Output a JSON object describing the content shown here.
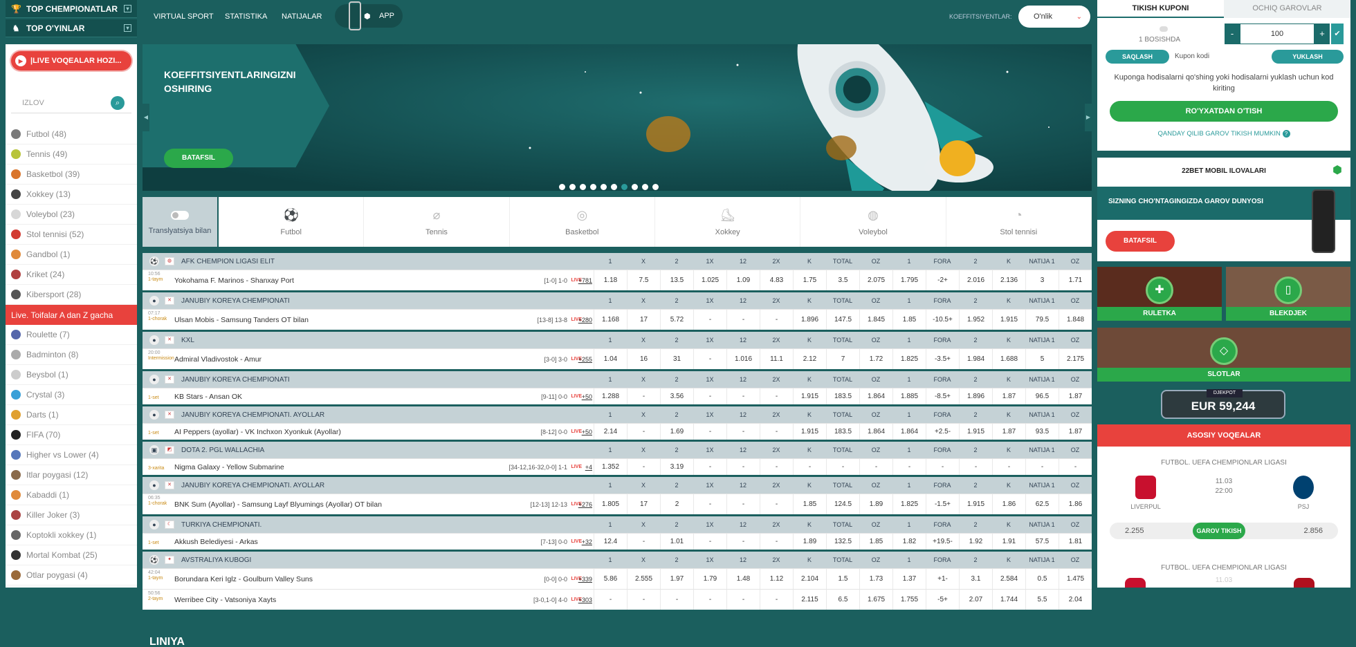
{
  "left": {
    "top_championships": "TOP CHEMPIONATLAR",
    "top_games": "TOP O'YINLAR",
    "live_button": "|LIVE VOQEALAR HOZI...",
    "search_placeholder": "IZLOV",
    "sports_a": [
      {
        "label": "Futbol (48)",
        "color": "#7a7a7a"
      },
      {
        "label": "Tennis (49)",
        "color": "#b8c43a"
      },
      {
        "label": "Basketbol (39)",
        "color": "#d9752b"
      },
      {
        "label": "Xokkey (13)",
        "color": "#444"
      },
      {
        "label": "Voleybol (23)",
        "color": "#d7d7d7"
      },
      {
        "label": "Stol tennisi (52)",
        "color": "#d23b32"
      },
      {
        "label": "Gandbol (1)",
        "color": "#e08a3a"
      },
      {
        "label": "Kriket (24)",
        "color": "#b04040"
      },
      {
        "label": "Kibersport (28)",
        "color": "#555"
      }
    ],
    "live_toggle": "Live. Toifalar A dan Z gacha",
    "sports_b": [
      {
        "label": "Roulette (7)",
        "color": "#5566aa"
      },
      {
        "label": "Badminton (8)",
        "color": "#aaaaaa"
      },
      {
        "label": "Beysbol (1)",
        "color": "#cccccc"
      },
      {
        "label": "Crystal (3)",
        "color": "#3aa0d8"
      },
      {
        "label": "Darts (1)",
        "color": "#e0a030"
      },
      {
        "label": "FIFA (70)",
        "color": "#222222"
      },
      {
        "label": "Higher vs Lower (4)",
        "color": "#5577bb"
      },
      {
        "label": "Itlar poygasi (12)",
        "color": "#8a6a4a"
      },
      {
        "label": "Kabaddi (1)",
        "color": "#e08a3a"
      },
      {
        "label": "Killer Joker (3)",
        "color": "#aa4444"
      },
      {
        "label": "Koptokli xokkey (1)",
        "color": "#666666"
      },
      {
        "label": "Mortal Kombat (25)",
        "color": "#333333"
      },
      {
        "label": "Otlar poygasi (4)",
        "color": "#9a6a3a"
      }
    ]
  },
  "nav": {
    "virtual_sport": "VIRTUAL SPORT",
    "statistika": "STATISTIKA",
    "natijalar": "NATIJALAR",
    "app": "APP",
    "koef_label": "KOEFFITSIYENTLAR:",
    "koef_value": "O'nlik"
  },
  "banner": {
    "title": "KOEFFITSIYENTLARINGIZNI OSHIRING",
    "button": "BATAFSIL"
  },
  "tabs": {
    "translation": "Translyatsiya bilan",
    "items": [
      "Futbol",
      "Tennis",
      "Basketbol",
      "Xokkey",
      "Voleybol",
      "Stol tennisi"
    ]
  },
  "columns": [
    "1",
    "X",
    "2",
    "1X",
    "12",
    "2X",
    "K",
    "TOTAL",
    "OZ",
    "1",
    "FORA",
    "2",
    "K",
    "NATIJA 1",
    "OZ"
  ],
  "events": [
    {
      "league": "AFK CHEMPION LIGASI ELIT",
      "icon": "⚽",
      "flag": "◍",
      "rows": [
        {
          "time": "10:56",
          "period": "1-taym",
          "name": "Yokohama F. Marinos - Shanxay Port",
          "score": "[1-0]  1-0",
          "plus": "+781",
          "odds": [
            "1.18",
            "7.5",
            "13.5",
            "1.025",
            "1.09",
            "4.83",
            "1.75",
            "3.5",
            "2.075",
            "1.795",
            "-2+",
            "2.016",
            "2.136",
            "3",
            "1.71"
          ]
        }
      ]
    },
    {
      "league": "JANUBIY KOREYA CHEMPIONATI",
      "icon": "●",
      "flag": "✕",
      "rows": [
        {
          "time": "07:17",
          "period": "1-chorak",
          "name": "Ulsan Mobis - Samsung Tanders OT bilan",
          "score": "[13-8]  13-8",
          "plus": "+280",
          "odds": [
            "1.168",
            "17",
            "5.72",
            "-",
            "-",
            "-",
            "1.896",
            "147.5",
            "1.845",
            "1.85",
            "-10.5+",
            "1.952",
            "1.915",
            "79.5",
            "1.848"
          ]
        }
      ]
    },
    {
      "league": "KXL",
      "icon": "●",
      "flag": "✕",
      "rows": [
        {
          "time": "20:00",
          "period": "Intermission",
          "name": "Admiral Vladivostok - Amur",
          "score": "[3-0]  3-0",
          "plus": "+255",
          "odds": [
            "1.04",
            "16",
            "31",
            "-",
            "1.016",
            "11.1",
            "2.12",
            "7",
            "1.72",
            "1.825",
            "-3.5+",
            "1.984",
            "1.688",
            "5",
            "2.175"
          ]
        }
      ]
    },
    {
      "league": "JANUBIY KOREYA CHEMPIONATI",
      "icon": "●",
      "flag": "✕",
      "rows": [
        {
          "time": "",
          "period": "1-set",
          "name": "KB Stars - Ansan OK",
          "score": "[9-11]  0-0",
          "plus": "+50",
          "odds": [
            "1.288",
            "-",
            "3.56",
            "-",
            "-",
            "-",
            "1.915",
            "183.5",
            "1.864",
            "1.885",
            "-8.5+",
            "1.896",
            "1.87",
            "96.5",
            "1.87"
          ]
        }
      ]
    },
    {
      "league": "JANUBIY KOREYA CHEMPIONATI. AYOLLAR",
      "icon": "●",
      "flag": "✕",
      "rows": [
        {
          "time": "",
          "period": "1-set",
          "name": "AI Peppers (ayollar) - VK Inchxon Xyonkuk (Ayollar)",
          "score": "[8-12]  0-0",
          "plus": "+50",
          "odds": [
            "2.14",
            "-",
            "1.69",
            "-",
            "-",
            "-",
            "1.915",
            "183.5",
            "1.864",
            "1.864",
            "+2.5-",
            "1.915",
            "1.87",
            "93.5",
            "1.87"
          ]
        }
      ]
    },
    {
      "league": "DOTA 2. PGL WALLACHIA",
      "icon": "▣",
      "flag": "◩",
      "rows": [
        {
          "time": "",
          "period": "3-xarita",
          "name": "Nigma Galaxy - Yellow Submarine",
          "score": "[34-12,16-32,0-0]  1-1",
          "plus": "+4",
          "odds": [
            "1.352",
            "-",
            "3.19",
            "-",
            "-",
            "-",
            "-",
            "-",
            "-",
            "-",
            "-",
            "-",
            "-",
            "-",
            "-"
          ]
        }
      ]
    },
    {
      "league": "JANUBIY KOREYA CHEMPIONATI. AYOLLAR",
      "icon": "●",
      "flag": "✕",
      "rows": [
        {
          "time": "06:35",
          "period": "1-chorak",
          "name": "BNK Sum (Ayollar) - Samsung Layf Blyumings (Ayollar) OT bilan",
          "score": "[12-13]  12-13",
          "plus": "+276",
          "odds": [
            "1.805",
            "17",
            "2",
            "-",
            "-",
            "-",
            "1.85",
            "124.5",
            "1.89",
            "1.825",
            "-1.5+",
            "1.915",
            "1.86",
            "62.5",
            "1.86"
          ]
        }
      ]
    },
    {
      "league": "TURKIYA CHEMPIONATI.",
      "icon": "●",
      "flag": "☾",
      "rows": [
        {
          "time": "",
          "period": "1-set",
          "name": "Akkush Belediyesi - Arkas",
          "score": "[7-13]  0-0",
          "plus": "+32",
          "odds": [
            "12.4",
            "-",
            "1.01",
            "-",
            "-",
            "-",
            "1.89",
            "132.5",
            "1.85",
            "1.82",
            "+19.5-",
            "1.92",
            "1.91",
            "57.5",
            "1.81"
          ]
        }
      ]
    },
    {
      "league": "AVSTRALIYA KUBOGI",
      "icon": "⚽",
      "flag": "✦",
      "rows": [
        {
          "time": "42:04",
          "period": "1-taym",
          "name": "Borundara Keri Iglz - Goulburn Valley Suns",
          "score": "[0-0]  0-0",
          "plus": "+339",
          "odds": [
            "5.86",
            "2.555",
            "1.97",
            "1.79",
            "1.48",
            "1.12",
            "2.104",
            "1.5",
            "1.73",
            "1.37",
            "+1-",
            "3.1",
            "2.584",
            "0.5",
            "1.475"
          ]
        },
        {
          "time": "50:56",
          "period": "2-taym",
          "name": "Werribee City - Vatsoniya Xayts",
          "score": "[3-0,1-0]  4-0",
          "plus": "+303",
          "odds": [
            "-",
            "-",
            "-",
            "-",
            "-",
            "-",
            "2.115",
            "6.5",
            "1.675",
            "1.755",
            "-5+",
            "2.07",
            "1.744",
            "5.5",
            "2.04"
          ]
        }
      ]
    }
  ],
  "live_badge": "LIVE",
  "liniya": "LINIYA",
  "coupon": {
    "tab1": "TIKISH KUPONI",
    "tab2": "OCHIQ GAROVLAR",
    "bosish": "1 BOSISHDA",
    "minus": "-",
    "stake": "100",
    "plus": "+",
    "save": "SAQLASH",
    "code_placeholder": "Kupon kodi",
    "load": "YUKLASH",
    "message": "Kuponga hodisalarni qo'shing yoki hodisalarni yuklash uchun kod kiriting",
    "register": "RO'YXATDAN O'TISH",
    "how": "QANDAY QILIB GAROV TIKISH MUMKIN"
  },
  "mobile": {
    "title": "22BET MOBIL ILOVALARI",
    "band": "SIZNING CHO'NTAGINGIZDA GAROV DUNYOSI",
    "button": "BATAFSIL"
  },
  "casino": {
    "roulette": "RULETKA",
    "blackjack": "BLEKDJEK",
    "slots": "SLOTLAR",
    "jackpot_label": "DJEKPOT",
    "jackpot_value": "EUR 59,244"
  },
  "main_events": {
    "title": "ASOSIY VOQEALAR",
    "league": "FUTBOL. UEFA CHEMPIONLAR LIGASI",
    "date": "11.03",
    "time": "22:00",
    "home": "LIVERPUL",
    "away": "PSJ",
    "odd_home": "2.255",
    "bet": "GAROV TIKISH",
    "odd_away": "2.856",
    "league2": "FUTBOL. UEFA CHEMPIONLAR LIGASI",
    "date2": "11.03"
  },
  "colors": {
    "accent_green": "#2ba84a",
    "accent_red": "#e8423d",
    "teal": "#1b5f5e"
  }
}
